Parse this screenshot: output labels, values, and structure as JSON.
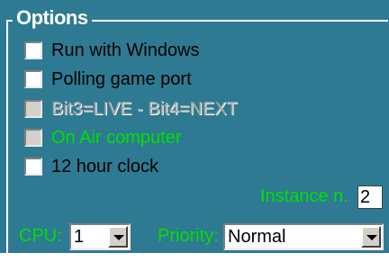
{
  "group": {
    "title": "Options"
  },
  "checkboxes": [
    {
      "label": "Run with Windows",
      "checked": false,
      "enabled": true
    },
    {
      "label": "Polling game port",
      "checked": false,
      "enabled": true
    },
    {
      "label": "Bit3=LIVE - Bit4=NEXT",
      "checked": false,
      "enabled": false
    },
    {
      "label": "On Air computer",
      "checked": false,
      "enabled": false
    },
    {
      "label": "12 hour clock",
      "checked": false,
      "enabled": true
    }
  ],
  "instance": {
    "label": "Instance n.",
    "value": "2"
  },
  "cpu": {
    "label": "CPU:",
    "value": "1"
  },
  "priority": {
    "label": "Priority:",
    "value": "Normal"
  },
  "colors": {
    "panel": "#2e7a92",
    "accent_green": "#00e000"
  }
}
